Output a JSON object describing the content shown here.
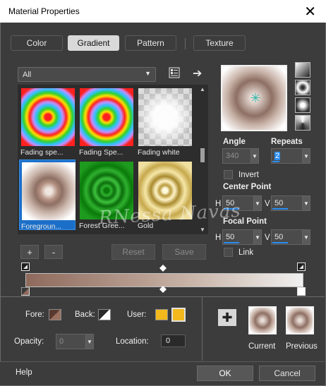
{
  "window": {
    "title": "Material Properties"
  },
  "tabs": [
    {
      "label": "Color",
      "active": false
    },
    {
      "label": "Gradient",
      "active": true
    },
    {
      "label": "Pattern",
      "active": false
    },
    {
      "label": "Texture",
      "active": false
    }
  ],
  "category": {
    "selected": "All"
  },
  "thumbnails": [
    {
      "label": "Fading spe...",
      "icon": "rainbow-radial"
    },
    {
      "label": "Fading Spe...",
      "icon": "rainbow-radial"
    },
    {
      "label": "Fading white",
      "icon": "checker-fade"
    },
    {
      "label": "Foregroun...",
      "icon": "brown-radial",
      "selected": true
    },
    {
      "label": "Forest Gree...",
      "icon": "green-radial"
    },
    {
      "label": "Gold",
      "icon": "gold-radial"
    }
  ],
  "list_buttons": {
    "add": "+",
    "remove": "-"
  },
  "actions": {
    "reset": "Reset",
    "save": "Save"
  },
  "angle": {
    "label": "Angle",
    "value": "340"
  },
  "repeats": {
    "label": "Repeats",
    "value": "2"
  },
  "invert": {
    "label": "Invert",
    "checked": false
  },
  "center_point": {
    "label": "Center Point",
    "h_label": "H",
    "h": "50",
    "v_label": "V",
    "v": "50"
  },
  "focal_point": {
    "label": "Focal Point",
    "h_label": "H",
    "h": "50",
    "v_label": "V",
    "v": "50"
  },
  "link": {
    "label": "Link",
    "checked": false
  },
  "bottom": {
    "fore_label": "Fore:",
    "back_label": "Back:",
    "user_label": "User:",
    "opacity_label": "Opacity:",
    "opacity_value": "0",
    "location_label": "Location:",
    "location_value": "0",
    "current_label": "Current",
    "previous_label": "Previous"
  },
  "footer": {
    "help": "Help",
    "ok": "OK",
    "cancel": "Cancel"
  },
  "watermark": "RNessa Navas",
  "colors": {
    "accent": "#2a8df0",
    "gradient_start": "#8e6a5c",
    "gradient_end": "#f0f0f0",
    "user_swatch": "#f2b81c"
  }
}
